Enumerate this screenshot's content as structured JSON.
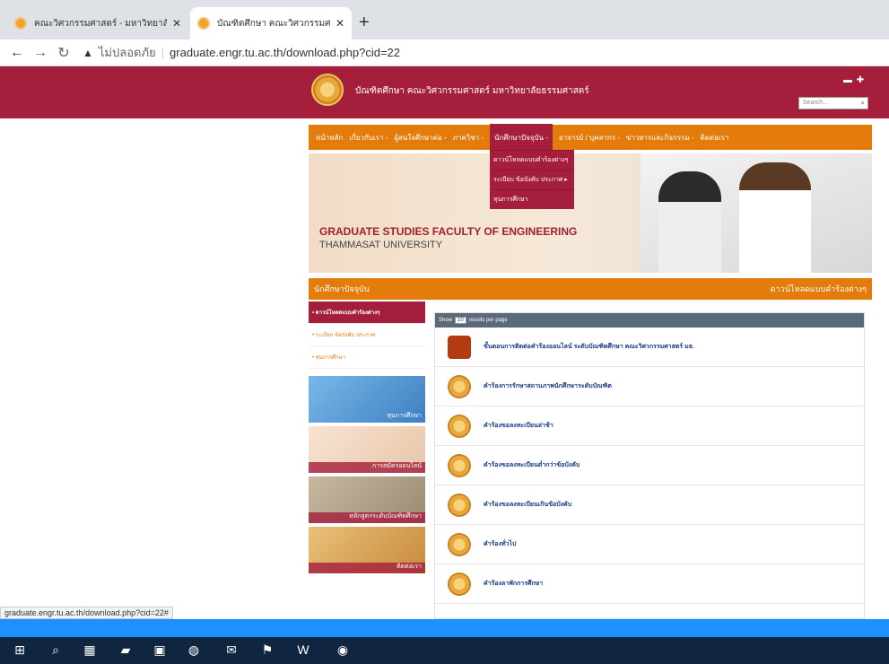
{
  "browser": {
    "tabs": [
      {
        "title": "คณะวิศวกรรมศาสตร์ - มหาวิทยาลัยธ"
      },
      {
        "title": "บัณฑิตศึกษา คณะวิศวกรรมศาสตร์ มห"
      }
    ],
    "omnibox": {
      "security": "ไม่ปลอดภัย",
      "url": "graduate.engr.tu.ac.th/download.php?cid=22"
    },
    "status_url": "graduate.engr.tu.ac.th/download.php?cid=22#"
  },
  "site": {
    "title": "บัณฑิตศึกษา คณะวิศวกรรมศาสตร์ มหาวิทยาลัยธรรมศาสตร์",
    "search_placeholder": "Search..."
  },
  "nav": {
    "items": [
      "หน้าหลัก",
      "เกี่ยวกับเรา -",
      "ผู้สนใจศึกษาต่อ -",
      "ภาควิชา -",
      "นักศึกษาปัจจุบัน -",
      "อาจารย์ / บุคลากร -",
      "ข่าวสารและกิจกรรม -",
      "ติดต่อเรา"
    ],
    "dropdown": [
      "ดาวน์โหลดแบบคำร้องต่างๆ",
      "ระเบียบ ข้อบังคับ ประกาศ ▸",
      "ทุนการศึกษา"
    ]
  },
  "banner": {
    "line1": "GRADUATE STUDIES FACULTY OF ENGINEERING",
    "line2": "THAMMASAT UNIVERSITY"
  },
  "section": {
    "left": "นักศึกษาปัจจุบัน",
    "right": "ดาวน์โหลดแบบคำร้องต่างๆ"
  },
  "sidebar": {
    "items": [
      "• ดาวน์โหลดแบบคำร้องต่างๆ",
      "• ระเบียบ ข้อบังคับ ประกาศ",
      "• ทุนการศึกษา"
    ],
    "banners": [
      "ทุนการศึกษา",
      "การสมัครออนไลน์",
      "หลักสูตรระดับบัณฑิตศึกษา",
      "ติดต่อเรา"
    ]
  },
  "downloads": {
    "show": "Show",
    "per_page": "10",
    "per_page_suffix": "results per page",
    "rows": [
      "ขั้นตอนการติดต่อคำร้องออนไลน์ ระดับบัณฑิตศึกษา คณะวิศวกรรมศาสตร์ มธ.",
      "คำร้องการรักษาสถานภาพนักศึกษาระดับบัณฑิต",
      "คำร้องขอลงทะเบียนล่าช้า",
      "คำร้องขอลงทะเบียนต่ำกว่าข้อบังคับ",
      "คำร้องขอลงทะเบียนเกินข้อบังคับ",
      "คำร้องทั่วไป",
      "คำร้องลาพักการศึกษา"
    ]
  }
}
